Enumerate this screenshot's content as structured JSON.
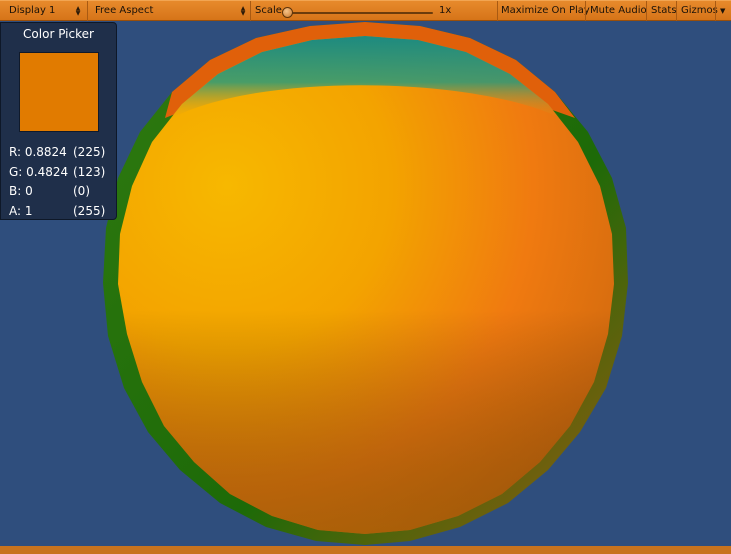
{
  "toolbar": {
    "display": "Display 1",
    "aspect": "Free Aspect",
    "scale_label": "Scale",
    "scale_value": "1x",
    "scale_level": 0.0,
    "maximize_on_play": "Maximize On Play",
    "mute_audio": "Mute Audio",
    "stats": "Stats",
    "gizmos": "Gizmos"
  },
  "color_picker": {
    "title": "Color Picker",
    "swatch_color": "#e17b00",
    "r_label": "R: 0.8824",
    "r_byte": "(225)",
    "g_label": "G: 0.4824",
    "g_byte": "(123)",
    "b_label": "B: 0",
    "b_byte": "(0)",
    "a_label": "A: 1",
    "a_byte": "(255)"
  },
  "colors": {
    "background": "#2f4e7d",
    "toolbar": "#d9791c",
    "sphere_orange": "#f57a10",
    "sphere_yellow": "#f4b800",
    "sphere_rim_green": "#1f6a10",
    "sphere_rim_teal": "#1f8a7a"
  }
}
